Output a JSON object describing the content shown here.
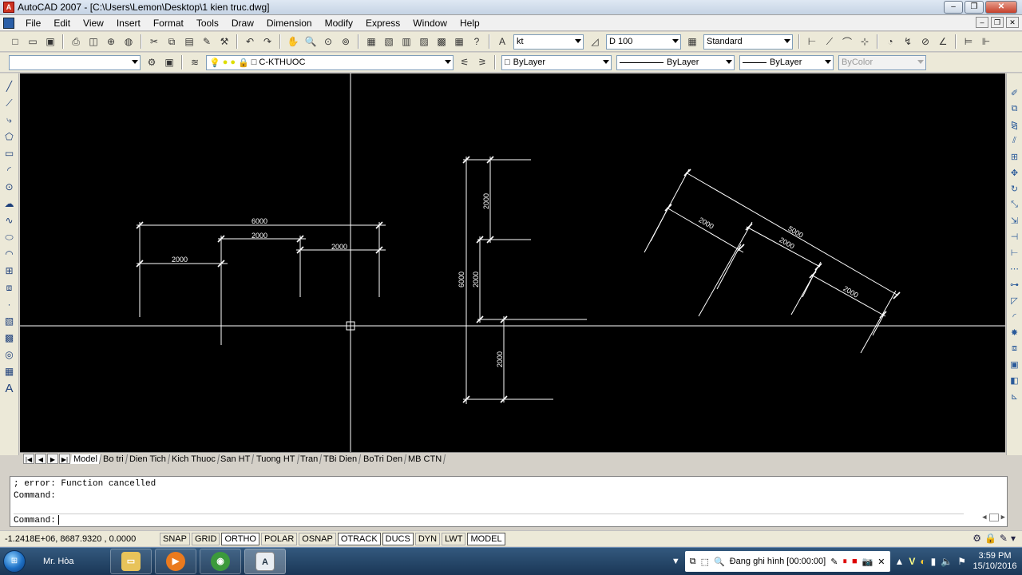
{
  "window": {
    "title": "AutoCAD 2007 - [C:\\Users\\Lemon\\Desktop\\1 kien truc.dwg]",
    "app_badge": "A"
  },
  "menu": [
    "File",
    "Edit",
    "View",
    "Insert",
    "Format",
    "Tools",
    "Draw",
    "Dimension",
    "Modify",
    "Express",
    "Window",
    "Help"
  ],
  "toolbar1": {
    "text_style": "kt",
    "dim_style": "D 100",
    "table_style": "Standard"
  },
  "toolbar2": {
    "workspace": "",
    "layer": "C-KTHUOC",
    "color": "ByLayer",
    "linetype": "ByLayer",
    "lineweight": "ByLayer",
    "plotstyle": "ByColor"
  },
  "left_tools": [
    "line-icon",
    "construction-line-icon",
    "polyline-icon",
    "polygon-icon",
    "rectangle-icon",
    "arc-icon",
    "circle-icon",
    "revision-cloud-icon",
    "spline-icon",
    "ellipse-icon",
    "ellipse-arc-icon",
    "insert-block-icon",
    "make-block-icon",
    "point-icon",
    "hatch-icon",
    "gradient-icon",
    "region-icon",
    "table-icon",
    "multiline-text-icon"
  ],
  "drawing": {
    "dims_left": [
      "6000",
      "2000",
      "2000",
      "2000"
    ],
    "dims_middle": [
      "2000",
      "6000",
      "2000",
      "2000"
    ],
    "dims_right": [
      "2000",
      "5000",
      "2000",
      "2000"
    ]
  },
  "layout_tabs": [
    "Model",
    "Bo tri",
    "Dien Tich",
    "Kich Thuoc",
    "San HT",
    "Tuong HT",
    "Tran",
    "TBi Dien",
    "BoTri Den",
    "MB CTN"
  ],
  "command": {
    "history": [
      "; error: Function cancelled",
      "Command:"
    ],
    "prompt": "Command:"
  },
  "status": {
    "coords": "-1.2418E+06, 8687.9320 , 0.0000",
    "buttons": [
      "SNAP",
      "GRID",
      "ORTHO",
      "POLAR",
      "OSNAP",
      "OTRACK",
      "DUCS",
      "DYN",
      "LWT",
      "MODEL"
    ],
    "pressed": [
      "ORTHO",
      "OTRACK",
      "DUCS",
      "MODEL"
    ]
  },
  "taskbar": {
    "user": "Mr. Hòa",
    "recording": "Đang ghi hình [00:00:00]",
    "time": "3:59 PM",
    "date": "15/10/2016"
  },
  "colors": {
    "canvas_bg": "#000000",
    "dim_line": "#ffffff"
  }
}
